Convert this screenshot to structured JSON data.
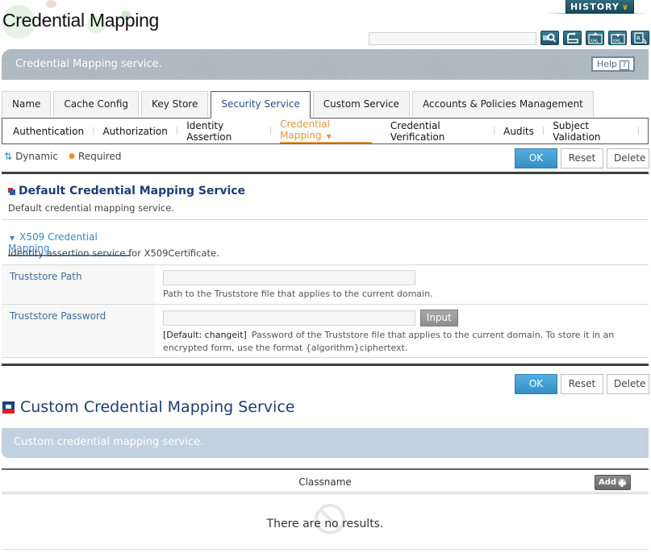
{
  "header": {
    "title": "Credential Mapping",
    "history_label": "HISTORY",
    "search": {
      "value": "",
      "placeholder": ""
    },
    "tools": [
      {
        "icon": "search-icon"
      },
      {
        "icon": "refresh-icon"
      },
      {
        "icon": "xml-export-icon"
      },
      {
        "icon": "xml-import-icon"
      },
      {
        "icon": "report-icon"
      }
    ]
  },
  "description_bar": {
    "text": "Credential Mapping service.",
    "help_label": "Help",
    "help_icon": "?"
  },
  "tabs": [
    {
      "label": "Name",
      "active": false
    },
    {
      "label": "Cache Config",
      "active": false
    },
    {
      "label": "Key Store",
      "active": false
    },
    {
      "label": "Security Service",
      "active": true
    },
    {
      "label": "Custom Service",
      "active": false
    },
    {
      "label": "Accounts & Policies Management",
      "active": false
    }
  ],
  "subnav": [
    {
      "label": "Authentication",
      "active": false
    },
    {
      "label": "Authorization",
      "active": false
    },
    {
      "label": "Identity Assertion",
      "active": false
    },
    {
      "label": "Credential Mapping",
      "active": true
    },
    {
      "label": "Credential Verification",
      "active": false
    },
    {
      "label": "Audits",
      "active": false
    },
    {
      "label": "Subject Validation",
      "active": false
    }
  ],
  "legend": {
    "dynamic": "Dynamic",
    "required": "Required"
  },
  "actions": {
    "ok": "OK",
    "reset": "Reset",
    "delete": "Delete"
  },
  "default_section": {
    "title": "Default Credential Mapping Service",
    "description": "Default credential mapping service.",
    "subsection": {
      "title": "X509 Credential Mapping",
      "description": "Identity assertion service for X509Certificate."
    },
    "properties": [
      {
        "label": "Truststore Path",
        "value": "",
        "help": "Path to the Truststore file that applies to the current domain."
      },
      {
        "label": "Truststore Password",
        "value": "",
        "button": "Input",
        "default": "[Default: changeit]",
        "help": "Password of the Truststore file that applies to the current domain. To store it in an encrypted form, use the format {algorithm}ciphertext."
      }
    ]
  },
  "custom_section": {
    "title": "Custom Credential Mapping Service",
    "description": "Custom credential mapping service.",
    "table": {
      "columns": [
        "Classname"
      ],
      "add_label": "Add",
      "empty_message": "There are no results."
    }
  }
}
